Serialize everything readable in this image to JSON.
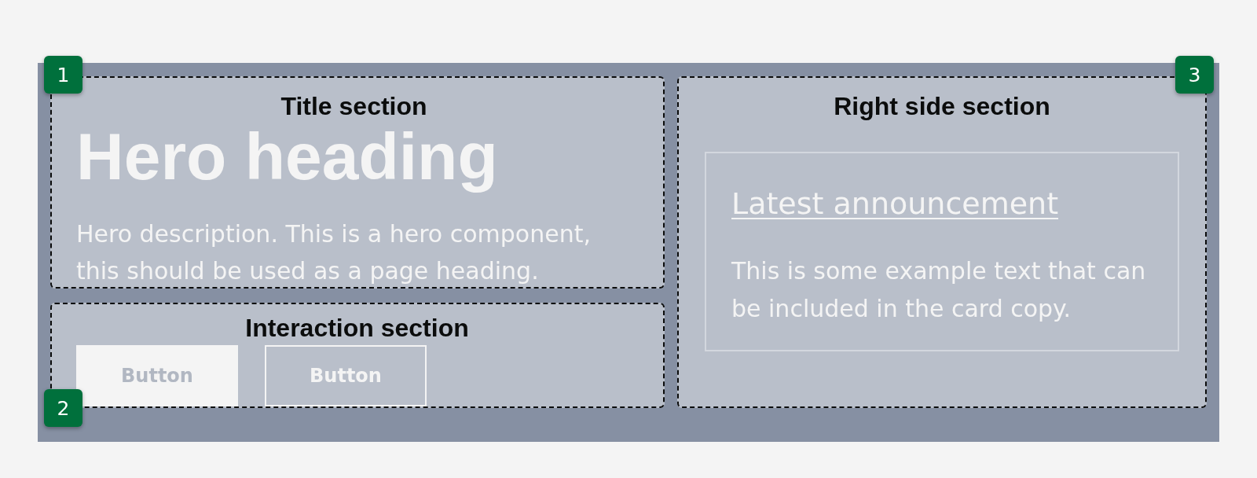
{
  "title_section": {
    "badge": "1",
    "label": "Title section",
    "heading": "Hero heading",
    "description": "Hero description. This is a hero component, this should be used as a page heading."
  },
  "interaction_section": {
    "badge": "2",
    "label": "Interaction section",
    "buttons": [
      {
        "kind": "filled",
        "label": "Button"
      },
      {
        "kind": "outline",
        "label": "Button"
      }
    ]
  },
  "right_side_section": {
    "badge": "3",
    "label": "Right side section",
    "card": {
      "title": "Latest announcement",
      "text": "This is some example text that can be included in the card copy."
    }
  }
}
